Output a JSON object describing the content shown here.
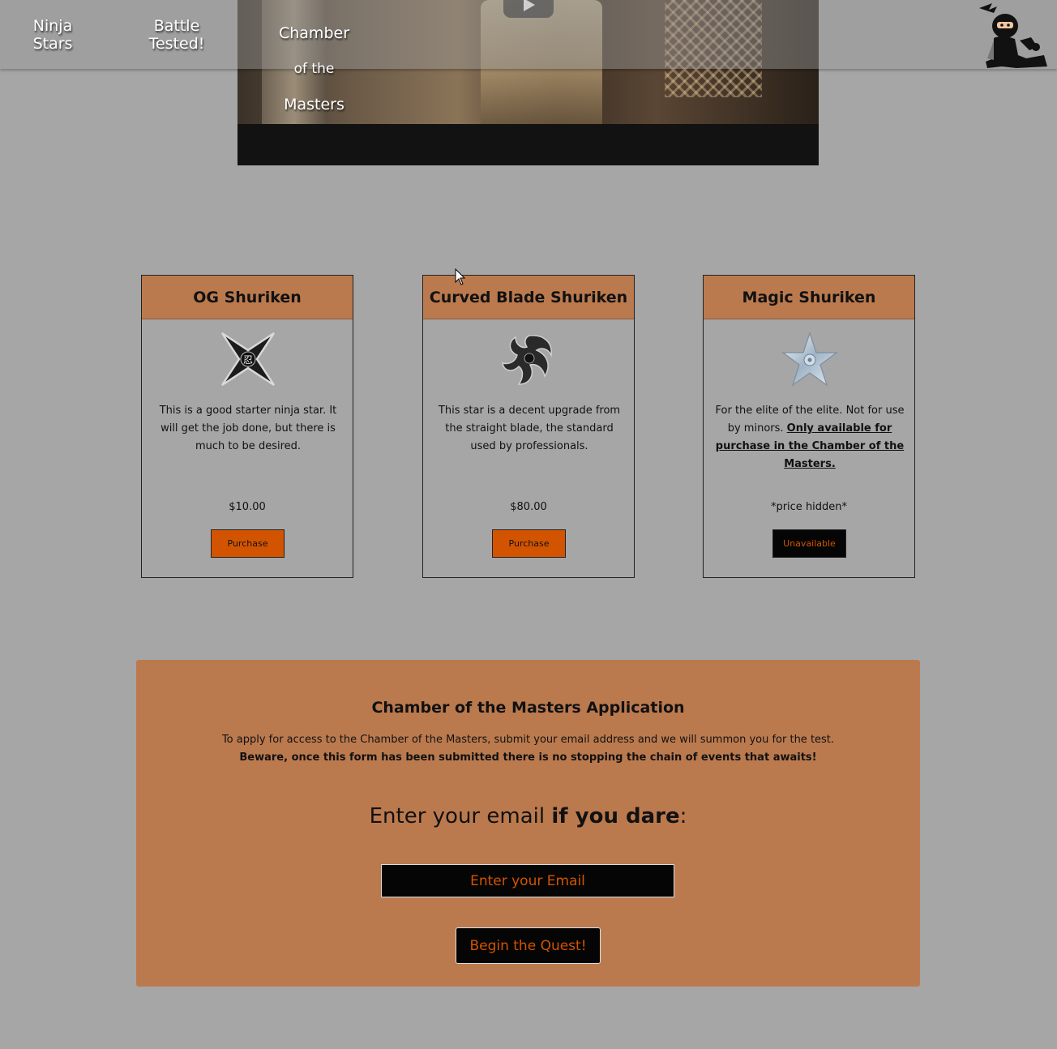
{
  "nav": {
    "links": [
      "Ninja\nStars",
      "Battle\nTested!"
    ],
    "chamber_line1": "Chamber",
    "chamber_line2": "of the",
    "chamber_line3": "Masters",
    "logo_icon": "ninja-logo-icon"
  },
  "video": {
    "play_icon": "play-icon"
  },
  "products": [
    {
      "title": "OG Shuriken",
      "icon": "og-shuriken-icon",
      "description": "This is a good starter ninja star. It will get the job done, but there is much to be desired.",
      "price": "$10.00",
      "button": "Purchase"
    },
    {
      "title": "Curved Blade Shuriken",
      "icon": "curved-shuriken-icon",
      "description": "This star is a decent upgrade from the straight blade, the standard used by professionals.",
      "price": "$80.00",
      "button": "Purchase"
    },
    {
      "title": "Magic Shuriken",
      "icon": "magic-shuriken-icon",
      "description": "For the elite of the elite. Not for use by minors.",
      "note": "Only available for purchase in the Chamber of the Masters.",
      "price": "*price hidden*",
      "button": "Unavailable"
    }
  ],
  "application": {
    "title": "Chamber of the Masters Application",
    "text": "To apply for access to the Chamber of the Masters, submit your email address and we will summon you for the test.",
    "warning": "Beware, once this form has been submitted there is no stopping the chain of events that awaits!",
    "prompt_start": "Enter your email ",
    "prompt_bold": "if you dare",
    "prompt_end": ":",
    "email_placeholder": "Enter your Email",
    "submit_label": "Begin the Quest!"
  },
  "colors": {
    "background": "#a6a6a6",
    "accent": "#bb7a4e",
    "button": "#d35400",
    "dark": "#050505"
  }
}
